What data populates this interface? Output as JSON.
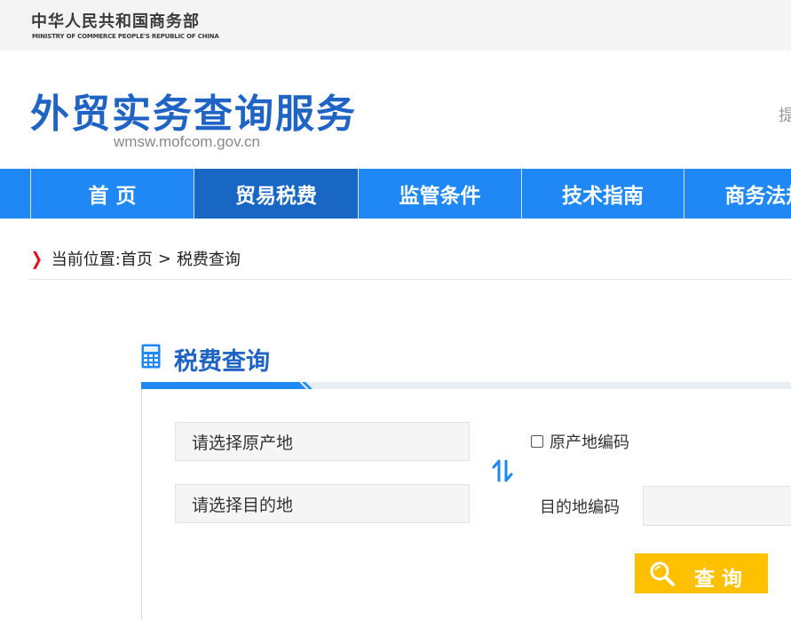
{
  "ministry": {
    "name_cn": "中华人民共和国商务部",
    "name_en": "MINISTRY OF COMMERCE PEOPLE'S REPUBLIC OF CHINA"
  },
  "site": {
    "title": "外贸实务查询服务",
    "url": "wmsw.mofcom.gov.cn",
    "header_right_text": "提"
  },
  "nav": {
    "items": [
      {
        "label": "首 页"
      },
      {
        "label": "贸易税费"
      },
      {
        "label": "监管条件"
      },
      {
        "label": "技术指南"
      },
      {
        "label": "商务法规"
      }
    ],
    "active_index": 1
  },
  "breadcrumb": {
    "prefix": "当前位置:",
    "home": "首页",
    "separator": ">",
    "current": "税费查询"
  },
  "section": {
    "title": "税费查询",
    "icon": "calculator-icon"
  },
  "form": {
    "origin_placeholder": "请选择原产地",
    "destination_placeholder": "请选择目的地",
    "origin_code_checkbox_label": "原产地编码",
    "origin_code_checked": false,
    "destination_code_label": "目的地编码",
    "destination_code_value": "",
    "swap_icon": "swap-arrows-icon",
    "search_button_label": "查询",
    "search_icon": "magnifier-icon"
  },
  "colors": {
    "brand_blue": "#1f64c4",
    "nav_blue": "#1f88f5",
    "nav_active": "#1867c5",
    "search_yellow": "#ffc000",
    "breadcrumb_arrow": "#d9151d"
  }
}
